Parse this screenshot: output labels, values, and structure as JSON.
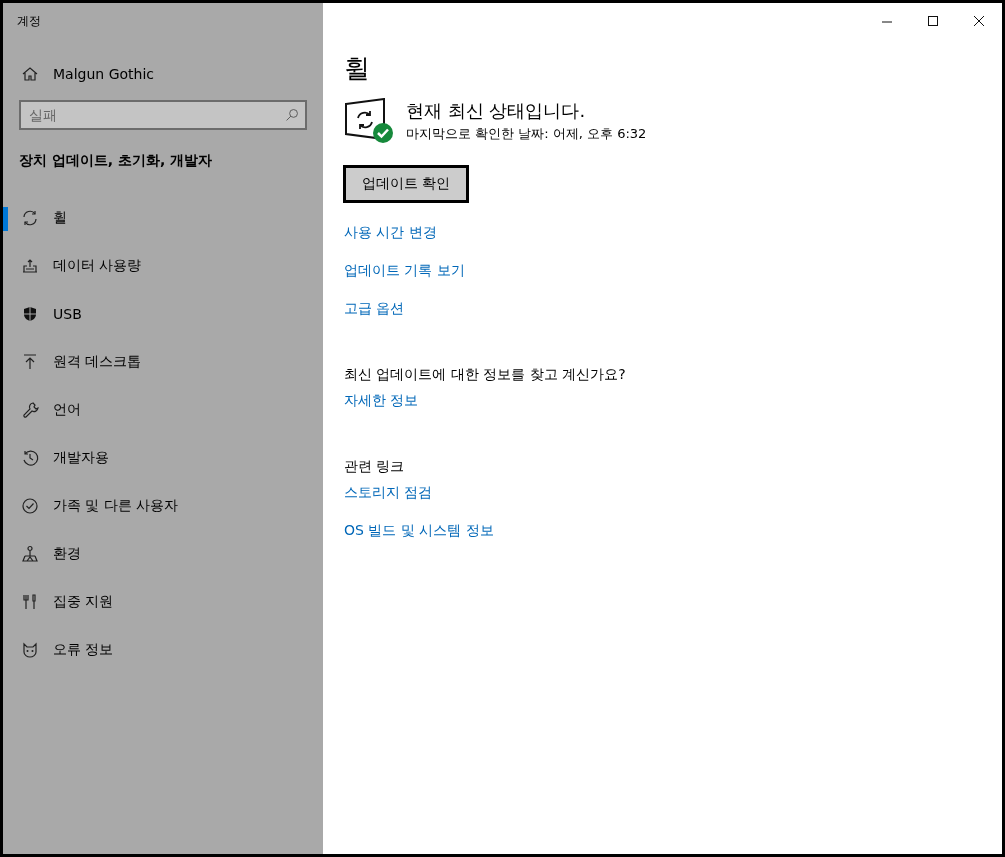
{
  "window": {
    "title": "계정",
    "controls": [
      {
        "kind": "minimize"
      },
      {
        "kind": "maximize"
      },
      {
        "kind": "close"
      }
    ]
  },
  "sidebar": {
    "home": "Malgun Gothic",
    "search": {
      "placeholder": "실패"
    },
    "section": "장치 업데이트, 초기화, 개발자",
    "items": [
      {
        "kind": "sync",
        "label": "휠",
        "selected": true
      },
      {
        "kind": "tray",
        "label": "데이터 사용량",
        "selected": false
      },
      {
        "kind": "shield",
        "label": "USB",
        "selected": false
      },
      {
        "kind": "upload",
        "label": "원격 데스크톱",
        "selected": false
      },
      {
        "kind": "wrench",
        "label": "언어",
        "selected": false
      },
      {
        "kind": "history",
        "label": "개발자용",
        "selected": false
      },
      {
        "kind": "check",
        "label": "가족 및 다른 사용자",
        "selected": false
      },
      {
        "kind": "person",
        "label": "환경",
        "selected": false
      },
      {
        "kind": "tools",
        "label": "집중 지원",
        "selected": false
      },
      {
        "kind": "cat",
        "label": "오류 정보",
        "selected": false
      }
    ]
  },
  "main": {
    "heading": "휠",
    "status": {
      "title": "현재 최신 상태입니다.",
      "subtitle": "마지막으로 확인한 날짜: 어제, 오후 6:32"
    },
    "button": "업데이트 확인",
    "links": [
      "사용 시간 변경",
      "업데이트 기록 보기",
      "고급 옵션"
    ],
    "info": {
      "question": "최신 업데이트에 대한 정보를 찾고 계신가요?",
      "link": "자세한 정보"
    },
    "related": {
      "heading": "관련 링크",
      "links": [
        "스토리지 점검",
        "OS 빌드 및 시스템 정보"
      ]
    }
  }
}
